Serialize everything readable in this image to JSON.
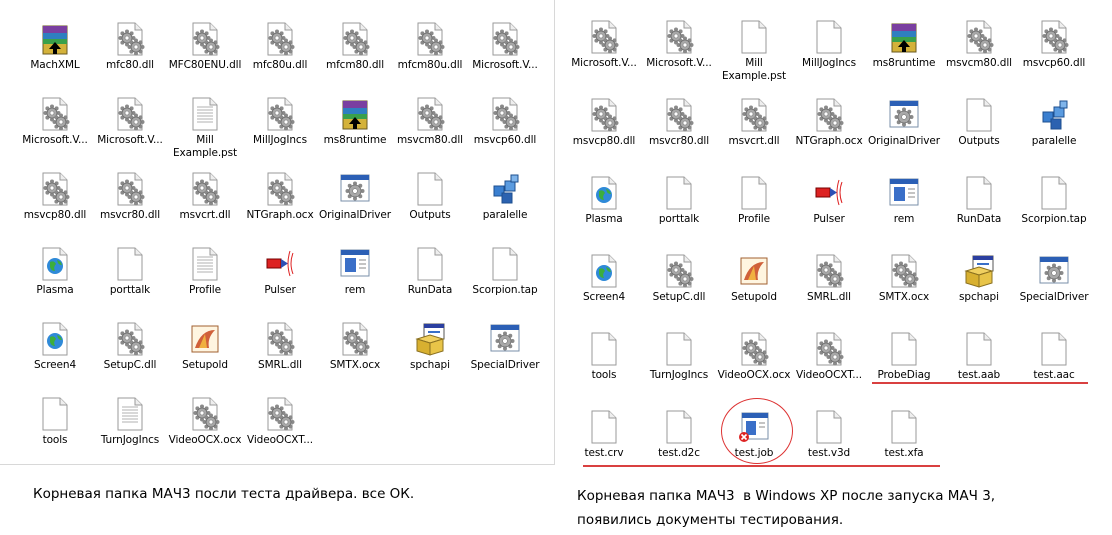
{
  "left_pane": {
    "items": [
      {
        "label": "MachXML",
        "icon": "winrar-archive-icon"
      },
      {
        "label": "mfc80.dll",
        "icon": "dll-gear-icon"
      },
      {
        "label": "MFC80ENU.dll",
        "icon": "dll-gear-icon"
      },
      {
        "label": "mfc80u.dll",
        "icon": "dll-gear-icon"
      },
      {
        "label": "mfcm80.dll",
        "icon": "dll-gear-icon"
      },
      {
        "label": "mfcm80u.dll",
        "icon": "dll-gear-icon"
      },
      {
        "label": "Microsoft.V...",
        "icon": "dll-gear-icon"
      },
      {
        "label": "Microsoft.V...",
        "icon": "dll-gear-icon"
      },
      {
        "label": "Microsoft.V...",
        "icon": "dll-gear-icon"
      },
      {
        "label": "Mill\nExample.pst",
        "icon": "document-icon"
      },
      {
        "label": "MillJogIncs",
        "icon": "dll-gear-icon"
      },
      {
        "label": "ms8runtime",
        "icon": "winrar-archive-icon"
      },
      {
        "label": "msvcm80.dll",
        "icon": "dll-gear-icon"
      },
      {
        "label": "msvcp60.dll",
        "icon": "dll-gear-icon"
      },
      {
        "label": "msvcp80.dll",
        "icon": "dll-gear-icon"
      },
      {
        "label": "msvcr80.dll",
        "icon": "dll-gear-icon"
      },
      {
        "label": "msvcrt.dll",
        "icon": "dll-gear-icon"
      },
      {
        "label": "NTGraph.ocx",
        "icon": "dll-gear-icon"
      },
      {
        "label": "OriginalDriver",
        "icon": "app-window-gear-icon"
      },
      {
        "label": "Outputs",
        "icon": "blank-file-icon"
      },
      {
        "label": "paralelle",
        "icon": "blue-cubes-icon"
      },
      {
        "label": "Plasma",
        "icon": "globe-icon"
      },
      {
        "label": "porttalk",
        "icon": "blank-file-icon"
      },
      {
        "label": "Profile",
        "icon": "document-icon"
      },
      {
        "label": "Pulser",
        "icon": "pulser-icon"
      },
      {
        "label": "rem",
        "icon": "app-window-icon"
      },
      {
        "label": "RunData",
        "icon": "blank-file-icon"
      },
      {
        "label": "Scorpion.tap",
        "icon": "blank-file-icon"
      },
      {
        "label": "Screen4",
        "icon": "globe-icon"
      },
      {
        "label": "SetupC.dll",
        "icon": "dll-gear-icon"
      },
      {
        "label": "Setupold",
        "icon": "setup-image-icon"
      },
      {
        "label": "SMRL.dll",
        "icon": "dll-gear-icon"
      },
      {
        "label": "SMTX.ocx",
        "icon": "dll-gear-icon"
      },
      {
        "label": "spchapi",
        "icon": "installer-box-icon"
      },
      {
        "label": "SpecialDriver",
        "icon": "app-window-gear-icon"
      },
      {
        "label": "tools",
        "icon": "blank-file-icon"
      },
      {
        "label": "TurnJogIncs",
        "icon": "document-icon"
      },
      {
        "label": "VideoOCX.ocx",
        "icon": "dll-gear-icon"
      },
      {
        "label": "VideoOCXT...",
        "icon": "dll-gear-icon"
      }
    ]
  },
  "right_pane": {
    "items": [
      {
        "label": "Microsoft.V...",
        "icon": "dll-gear-icon"
      },
      {
        "label": "Microsoft.V...",
        "icon": "dll-gear-icon"
      },
      {
        "label": "Mill\nExample.pst",
        "icon": "blank-file-icon"
      },
      {
        "label": "MillJogIncs",
        "icon": "blank-file-icon"
      },
      {
        "label": "ms8runtime",
        "icon": "winrar-archive-icon"
      },
      {
        "label": "msvcm80.dll",
        "icon": "dll-gear-icon"
      },
      {
        "label": "msvcp60.dll",
        "icon": "dll-gear-icon"
      },
      {
        "label": "msvcp80.dll",
        "icon": "dll-gear-icon"
      },
      {
        "label": "msvcr80.dll",
        "icon": "dll-gear-icon"
      },
      {
        "label": "msvcrt.dll",
        "icon": "dll-gear-icon"
      },
      {
        "label": "NTGraph.ocx",
        "icon": "dll-gear-icon"
      },
      {
        "label": "OriginalDriver",
        "icon": "app-window-gear-icon"
      },
      {
        "label": "Outputs",
        "icon": "blank-file-icon"
      },
      {
        "label": "paralelle",
        "icon": "blue-cubes-icon"
      },
      {
        "label": "Plasma",
        "icon": "globe-icon"
      },
      {
        "label": "porttalk",
        "icon": "blank-file-icon"
      },
      {
        "label": "Profile",
        "icon": "blank-file-icon"
      },
      {
        "label": "Pulser",
        "icon": "pulser-icon"
      },
      {
        "label": "rem",
        "icon": "app-window-icon"
      },
      {
        "label": "RunData",
        "icon": "blank-file-icon"
      },
      {
        "label": "Scorpion.tap",
        "icon": "blank-file-icon"
      },
      {
        "label": "Screen4",
        "icon": "globe-icon"
      },
      {
        "label": "SetupC.dll",
        "icon": "dll-gear-icon"
      },
      {
        "label": "Setupold",
        "icon": "setup-image-icon"
      },
      {
        "label": "SMRL.dll",
        "icon": "dll-gear-icon"
      },
      {
        "label": "SMTX.ocx",
        "icon": "dll-gear-icon"
      },
      {
        "label": "spchapi",
        "icon": "installer-box-icon"
      },
      {
        "label": "SpecialDriver",
        "icon": "app-window-gear-icon"
      },
      {
        "label": "tools",
        "icon": "blank-file-icon"
      },
      {
        "label": "TurnJogIncs",
        "icon": "blank-file-icon"
      },
      {
        "label": "VideoOCX.ocx",
        "icon": "dll-gear-icon"
      },
      {
        "label": "VideoOCXT...",
        "icon": "dll-gear-icon"
      },
      {
        "label": "ProbeDiag",
        "icon": "blank-file-icon"
      },
      {
        "label": "test.aab",
        "icon": "blank-file-icon"
      },
      {
        "label": "test.aac",
        "icon": "blank-file-icon"
      },
      {
        "label": "test.crv",
        "icon": "blank-file-icon"
      },
      {
        "label": "test.d2c",
        "icon": "blank-file-icon"
      },
      {
        "label": "test.job",
        "icon": "app-window-error-icon"
      },
      {
        "label": "test.v3d",
        "icon": "blank-file-icon"
      },
      {
        "label": "test.xfa",
        "icon": "blank-file-icon"
      }
    ]
  },
  "captions": {
    "left": "Корневая папка МАЧ3 посли теста драйвера. все ОК.",
    "right_line1": "Корневая папка МАЧ3  в Windows XP после запуска МАЧ 3,",
    "right_line2": "появились документы тестирования."
  },
  "annotation": {
    "color": "#d94040"
  }
}
